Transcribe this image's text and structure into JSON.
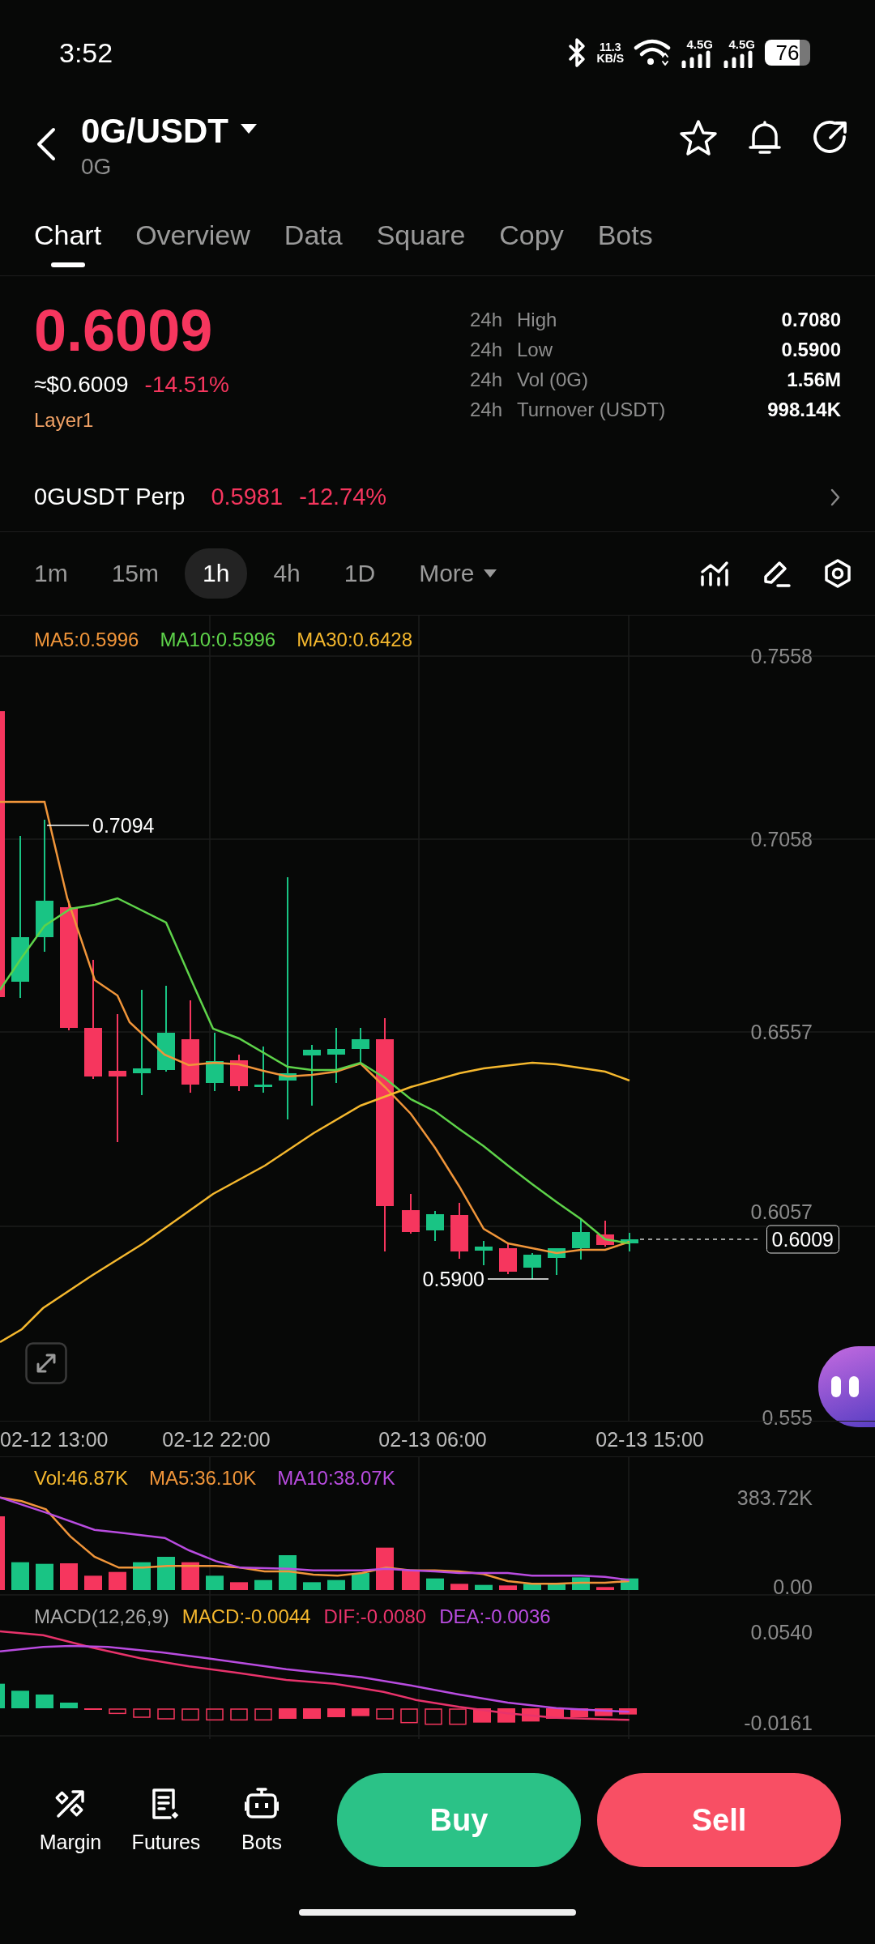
{
  "status_bar": {
    "time": "3:52",
    "net_speed_value": "11.3",
    "net_speed_unit": "KB/S",
    "signals": [
      "4.5G",
      "4.5G"
    ],
    "battery": "76"
  },
  "header": {
    "pair": "0G/USDT",
    "subtitle": "0G"
  },
  "tabs": [
    {
      "label": "Chart",
      "selected": true
    },
    {
      "label": "Overview",
      "selected": false
    },
    {
      "label": "Data",
      "selected": false
    },
    {
      "label": "Square",
      "selected": false
    },
    {
      "label": "Copy",
      "selected": false
    },
    {
      "label": "Bots",
      "selected": false
    }
  ],
  "price": {
    "last": "0.6009",
    "usd": "≈$0.6009",
    "change": "-14.51%",
    "tag": "Layer1"
  },
  "stats": [
    {
      "period": "24h",
      "label": "High",
      "value": "0.7080"
    },
    {
      "period": "24h",
      "label": "Low",
      "value": "0.5900"
    },
    {
      "period": "24h",
      "label": "Vol (0G)",
      "value": "1.56M"
    },
    {
      "period": "24h",
      "label": "Turnover (USDT)",
      "value": "998.14K"
    }
  ],
  "perp": {
    "name": "0GUSDT Perp",
    "price": "0.5981",
    "change": "-12.74%"
  },
  "intervals": [
    {
      "label": "1m",
      "selected": false,
      "kind": "option"
    },
    {
      "label": "15m",
      "selected": false,
      "kind": "option"
    },
    {
      "label": "1h",
      "selected": true,
      "kind": "option"
    },
    {
      "label": "4h",
      "selected": false,
      "kind": "option"
    },
    {
      "label": "1D",
      "selected": false,
      "kind": "option"
    },
    {
      "label": "More",
      "selected": false,
      "kind": "dropdown"
    }
  ],
  "chart": {
    "legend": [
      {
        "text": "MA5:0.5996",
        "color": "#f0953a"
      },
      {
        "text": "MA10:0.5996",
        "color": "#5ed34a"
      },
      {
        "text": "MA30:0.6428",
        "color": "#f5b82e"
      }
    ],
    "y_labels": [
      "0.7558",
      "0.7058",
      "0.6557",
      "0.6057",
      "0.555"
    ],
    "x_labels": [
      "02-12 13:00",
      "02-12 22:00",
      "02-13 06:00",
      "02-13 15:00"
    ],
    "high_marker": "0.7094",
    "low_marker": "0.5900",
    "last_price": "0.6009"
  },
  "volume": {
    "legend": [
      {
        "text": "Vol:46.87K",
        "color": "#f5b82e"
      },
      {
        "text": "MA5:36.10K",
        "color": "#f0953a"
      },
      {
        "text": "MA10:38.07K",
        "color": "#b94ce0"
      }
    ],
    "y_labels": [
      "383.72K",
      "0.00"
    ]
  },
  "macd": {
    "legend": [
      {
        "text": "MACD(12,26,9)",
        "color": "#aaaaaa"
      },
      {
        "text": "MACD:-0.0044",
        "color": "#f5b82e"
      },
      {
        "text": "DIF:-0.0080",
        "color": "#e8336b"
      },
      {
        "text": "DEA:-0.0036",
        "color": "#b94ce0"
      }
    ],
    "y_labels": [
      "0.0540",
      "-0.0161"
    ]
  },
  "bottom_nav": [
    {
      "label": "Margin",
      "kind": "margin"
    },
    {
      "label": "Futures",
      "kind": "futures"
    },
    {
      "label": "Bots",
      "kind": "bots"
    }
  ],
  "actions": [
    {
      "label": "Buy",
      "kind": "buy"
    },
    {
      "label": "Sell",
      "kind": "sell"
    }
  ]
}
